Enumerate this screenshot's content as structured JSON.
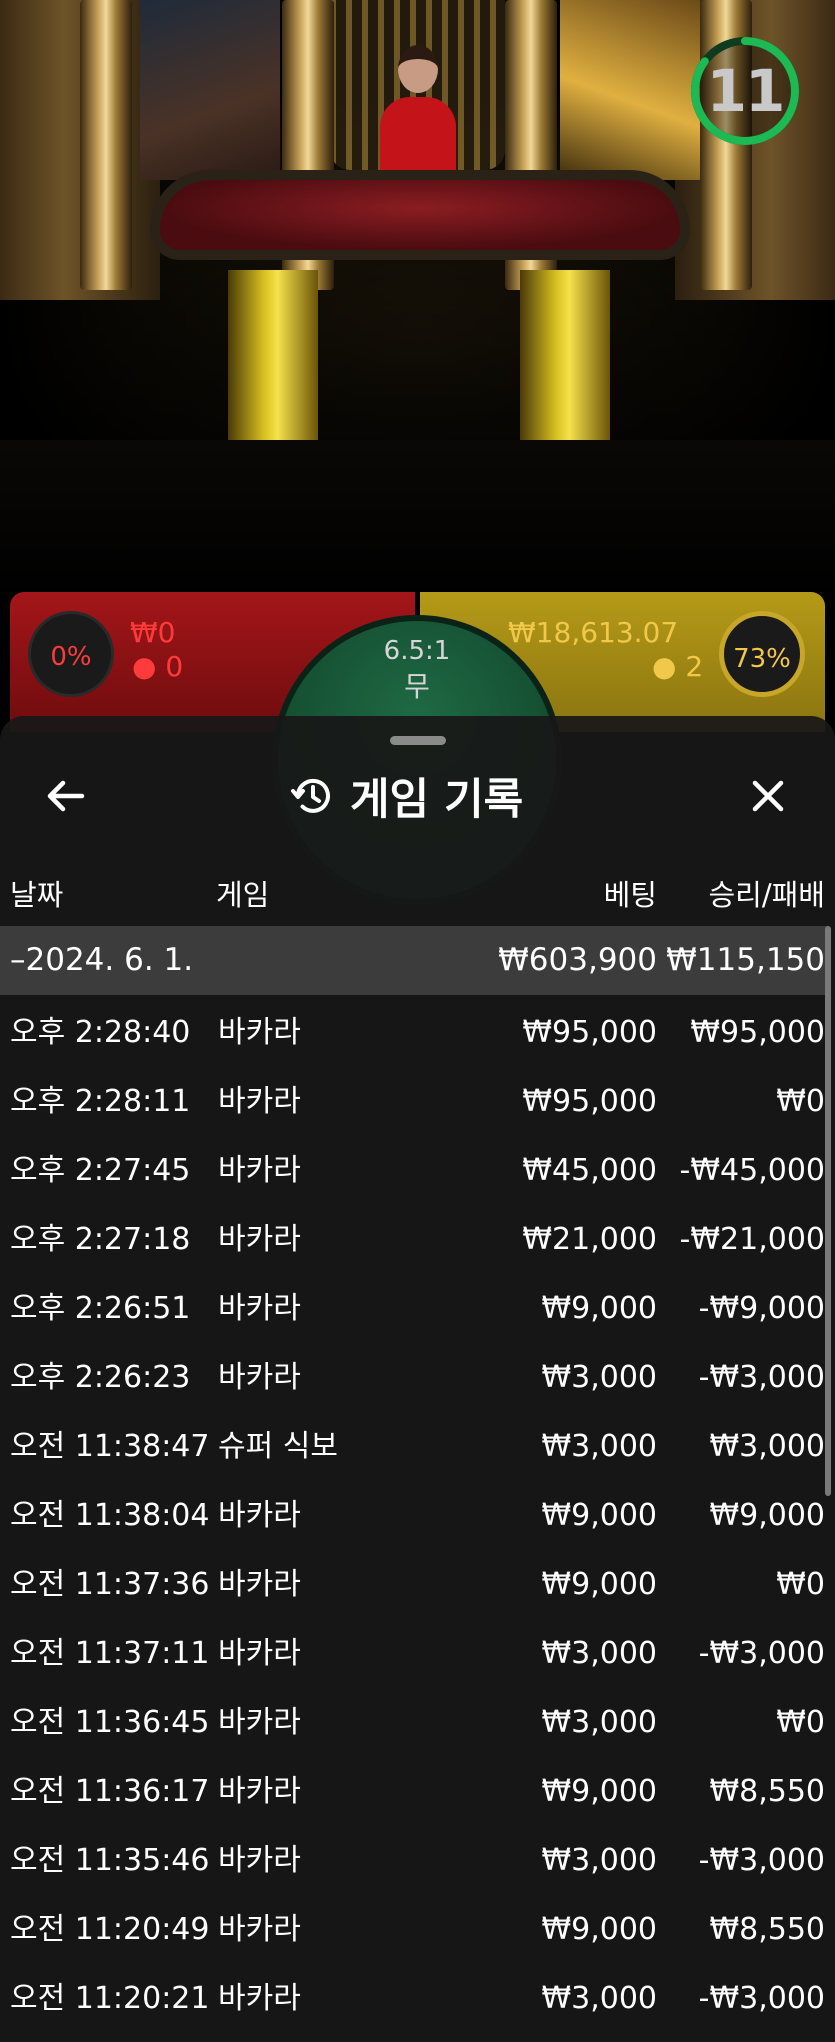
{
  "timer": {
    "seconds": "11",
    "progress": 0.85,
    "color": "#1db954"
  },
  "bets": {
    "left": {
      "percent": "0%",
      "amount": "₩0",
      "players": "0",
      "color": "#ff3a3a"
    },
    "right": {
      "percent": "73%",
      "amount": "₩18,613.07",
      "players": "2",
      "color": "#f1c84a"
    },
    "tie": {
      "payout": "6.5:1",
      "label": "무"
    }
  },
  "history": {
    "title": "게임 기록",
    "columns": {
      "date": "날짜",
      "game": "게임",
      "bet": "베팅",
      "result": "승리/패배"
    },
    "day": {
      "date": "–2024. 6. 1.",
      "bet": "₩603,900",
      "result": "₩115,150"
    },
    "rows": [
      {
        "time": "오후 2:28:40",
        "game": "바카라",
        "bet": "₩95,000",
        "result": "₩95,000"
      },
      {
        "time": "오후 2:28:11",
        "game": "바카라",
        "bet": "₩95,000",
        "result": "₩0"
      },
      {
        "time": "오후 2:27:45",
        "game": "바카라",
        "bet": "₩45,000",
        "result": "-₩45,000"
      },
      {
        "time": "오후 2:27:18",
        "game": "바카라",
        "bet": "₩21,000",
        "result": "-₩21,000"
      },
      {
        "time": "오후 2:26:51",
        "game": "바카라",
        "bet": "₩9,000",
        "result": "-₩9,000"
      },
      {
        "time": "오후 2:26:23",
        "game": "바카라",
        "bet": "₩3,000",
        "result": "-₩3,000"
      },
      {
        "time": "오전 11:38:47",
        "game": "슈퍼 식보",
        "bet": "₩3,000",
        "result": "₩3,000"
      },
      {
        "time": "오전 11:38:04",
        "game": "바카라",
        "bet": "₩9,000",
        "result": "₩9,000"
      },
      {
        "time": "오전 11:37:36",
        "game": "바카라",
        "bet": "₩9,000",
        "result": "₩0"
      },
      {
        "time": "오전 11:37:11",
        "game": "바카라",
        "bet": "₩3,000",
        "result": "-₩3,000"
      },
      {
        "time": "오전 11:36:45",
        "game": "바카라",
        "bet": "₩3,000",
        "result": "₩0"
      },
      {
        "time": "오전 11:36:17",
        "game": "바카라",
        "bet": "₩9,000",
        "result": "₩8,550"
      },
      {
        "time": "오전 11:35:46",
        "game": "바카라",
        "bet": "₩3,000",
        "result": "-₩3,000"
      },
      {
        "time": "오전 11:20:49",
        "game": "바카라",
        "bet": "₩9,000",
        "result": "₩8,550"
      },
      {
        "time": "오전 11:20:21",
        "game": "바카라",
        "bet": "₩3,000",
        "result": "-₩3,000"
      }
    ]
  },
  "icons": {
    "back": "arrow-left-icon",
    "close": "close-icon",
    "history": "history-clock-icon"
  }
}
